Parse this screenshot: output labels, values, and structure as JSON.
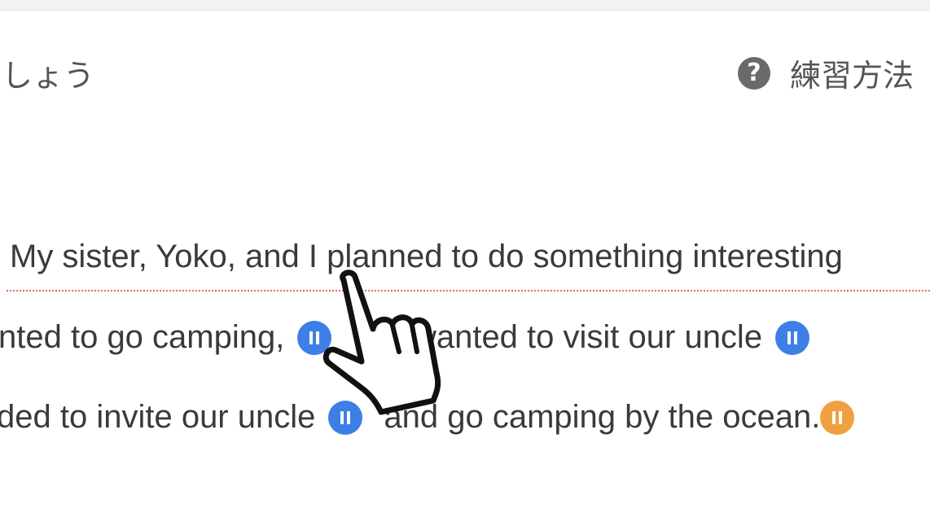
{
  "header": {
    "instruction_text": "しょう",
    "help_icon": "question-circle-icon",
    "help_label": "練習方法"
  },
  "passage": {
    "line1": "My sister, Yoko, and I planned to do something interesting",
    "line2_part1": "nted to go camping,",
    "line2_part2": "d I wanted to visit our uncle",
    "line3_part1": "ded to invite our uncle",
    "line3_part2": "and go camping by the ocean."
  },
  "audio_buttons": [
    {
      "icon": "pause-icon",
      "color": "#3d7fe6"
    },
    {
      "icon": "pause-icon",
      "color": "#3d7fe6"
    },
    {
      "icon": "pause-icon",
      "color": "#3d7fe6"
    },
    {
      "icon": "pause-icon",
      "color": "#f0a040"
    }
  ],
  "cursor": "hand-pointer-icon",
  "colors": {
    "accent_blue": "#3d7fe6",
    "accent_orange": "#f0a040",
    "underline_red": "#e06a60"
  }
}
